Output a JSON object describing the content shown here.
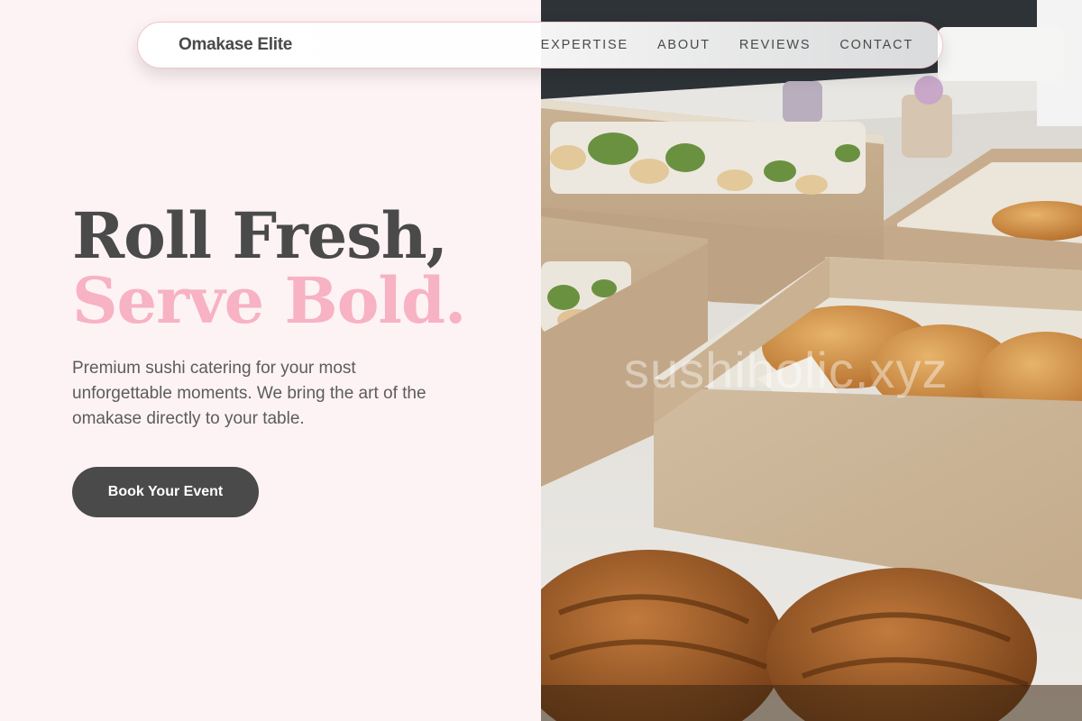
{
  "nav": {
    "brand": "Omakase Elite",
    "links": [
      {
        "label": "EXPERTISE"
      },
      {
        "label": "ABOUT"
      },
      {
        "label": "REVIEWS"
      },
      {
        "label": "CONTACT"
      }
    ]
  },
  "hero": {
    "title_line1": "Roll Fresh,",
    "title_line2": "Serve Bold.",
    "subtitle": "Premium sushi catering for your most unforgettable moments. We bring the art of the omakase directly to your table.",
    "cta_label": "Book Your Event",
    "image_watermark": "sushiholic.xyz"
  },
  "colors": {
    "background": "#fdf3f4",
    "text_dark": "#4a4a4a",
    "accent_pink": "#f7b2c4",
    "button_bg": "#4a4a4a"
  }
}
